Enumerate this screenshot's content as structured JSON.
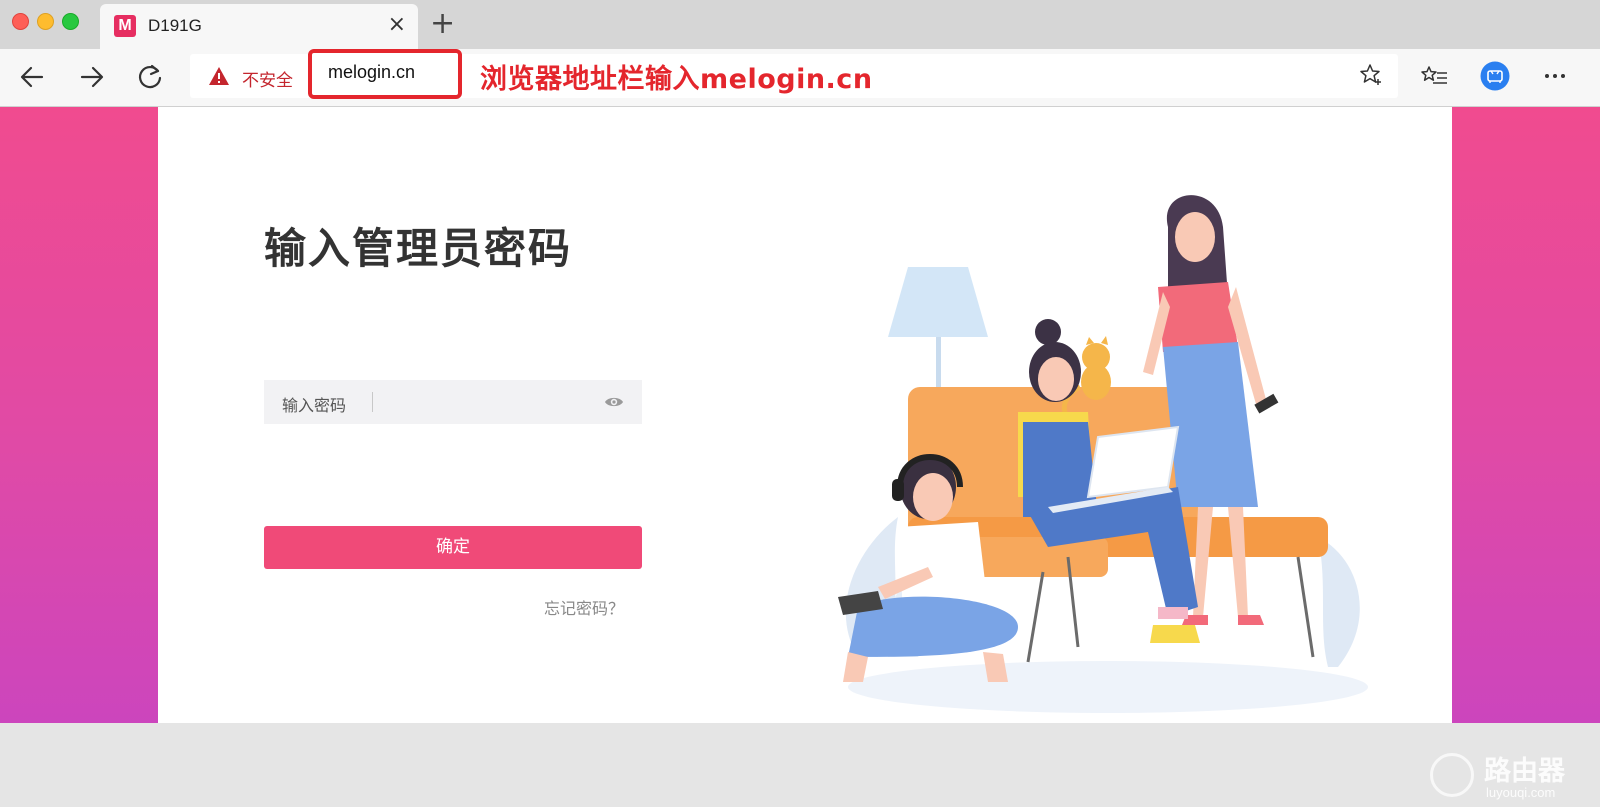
{
  "browser": {
    "tab": {
      "favicon_letter": "M",
      "title": "D191G",
      "close": "×"
    },
    "new_tab": "+",
    "address_bar": {
      "security_label": "不安全",
      "url": "melogin.cn",
      "annotation": "浏览器地址栏输入melogin.cn"
    }
  },
  "login": {
    "title": "输入管理员密码",
    "password_label": "输入密码",
    "password_value": "",
    "confirm_button": "确定",
    "forgot_link": "忘记密码？"
  },
  "watermark": {
    "main": "路由器",
    "sub": "luyouqi.com"
  },
  "colors": {
    "accent": "#f04a78",
    "warning": "#e4262d",
    "page_gradient_top": "#f04b8f",
    "page_gradient_bottom": "#cc45bd"
  }
}
